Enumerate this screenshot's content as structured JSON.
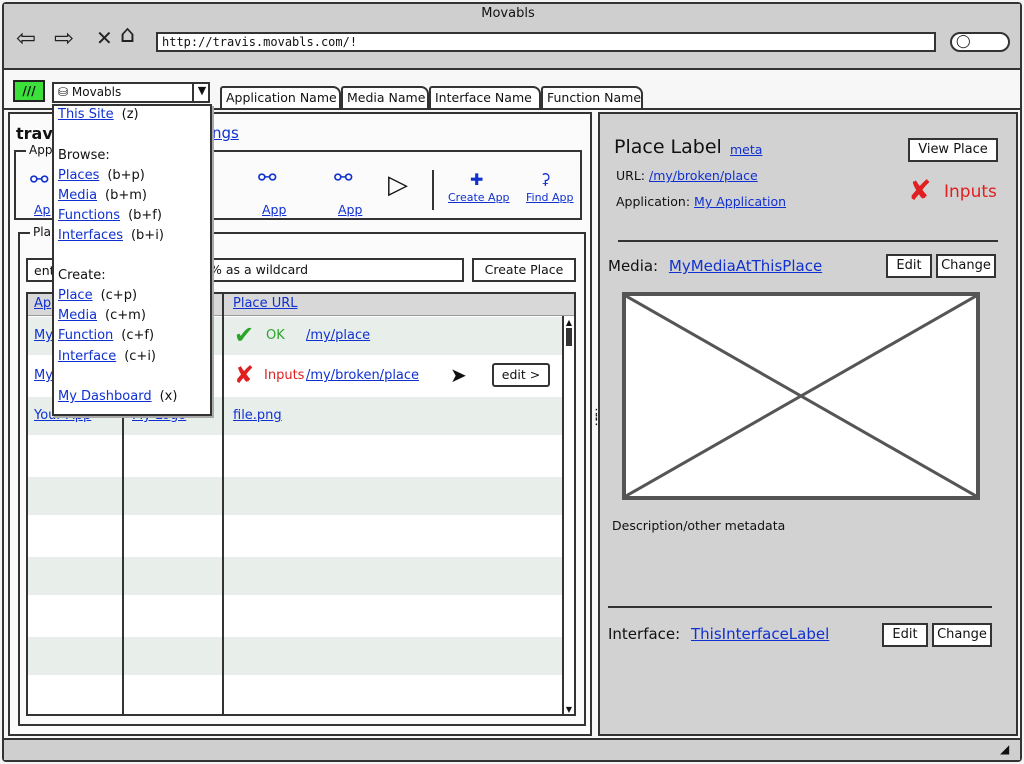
{
  "window": {
    "title": "Movabls",
    "url": "http://travis.movabls.com/!"
  },
  "menu_icon_label": "///",
  "site_select": {
    "value": "Movabls"
  },
  "tabs": [
    {
      "label": "Application Name"
    },
    {
      "label": "Media Name"
    },
    {
      "label": "Interface Name"
    },
    {
      "label": "Function Name"
    }
  ],
  "dropdown": {
    "this_site": "This Site",
    "this_site_key": "(z)",
    "browse_heading": "Browse:",
    "browse": [
      {
        "label": "Places",
        "key": "(b+p)"
      },
      {
        "label": "Media",
        "key": "(b+m)"
      },
      {
        "label": "Functions",
        "key": "(b+f)"
      },
      {
        "label": "Interfaces",
        "key": "(b+i)"
      }
    ],
    "create_heading": "Create:",
    "create": [
      {
        "label": "Place",
        "key": "(c+p)"
      },
      {
        "label": "Media",
        "key": "(c+m)"
      },
      {
        "label": "Function",
        "key": "(c+f)"
      },
      {
        "label": "Interface",
        "key": "(c+i)"
      }
    ],
    "dashboard": "My Dashboard",
    "dashboard_key": "(x)"
  },
  "left": {
    "heading": "travi",
    "settings_link": "ngs",
    "apps_legend": "App",
    "apps": [
      {
        "label": "Ap"
      },
      {
        "label": "App"
      },
      {
        "label": "App"
      }
    ],
    "create_app": "Create App",
    "find_app": "Find App",
    "places_legend": "Pla",
    "filter_value": "ent",
    "filter_hint": "% as a wildcard",
    "create_place_button": "Create Place",
    "columns": {
      "col1": "Ap",
      "col3": "Place URL"
    },
    "rows": [
      {
        "col1": "My",
        "status_label": "OK",
        "status": "ok",
        "url": "/my/place"
      },
      {
        "col1": "My",
        "status_label": "Inputs",
        "status": "error",
        "url": "/my/broken/place",
        "action": "edit >"
      },
      {
        "col1": "Your App",
        "col2": "My Logo",
        "url": "file.png"
      }
    ]
  },
  "right": {
    "place_label": "Place Label",
    "meta_link": "meta",
    "view_place_button": "View Place",
    "url_label": "URL:",
    "url_value": "/my/broken/place",
    "application_label": "Application:",
    "application_value": "My Application",
    "inputs_status": "Inputs",
    "media_label": "Media:",
    "media_value": "MyMediaAtThisPlace",
    "media_edit": "Edit",
    "media_change": "Change",
    "description": "Description/other metadata",
    "interface_label": "Interface:",
    "interface_value": "ThisInterfaceLabel",
    "interface_edit": "Edit",
    "interface_change": "Change"
  },
  "colors": {
    "accent_link": "#1030d0",
    "ok": "#2aa52a",
    "error": "#e02020",
    "menu_square": "#3be03b"
  }
}
